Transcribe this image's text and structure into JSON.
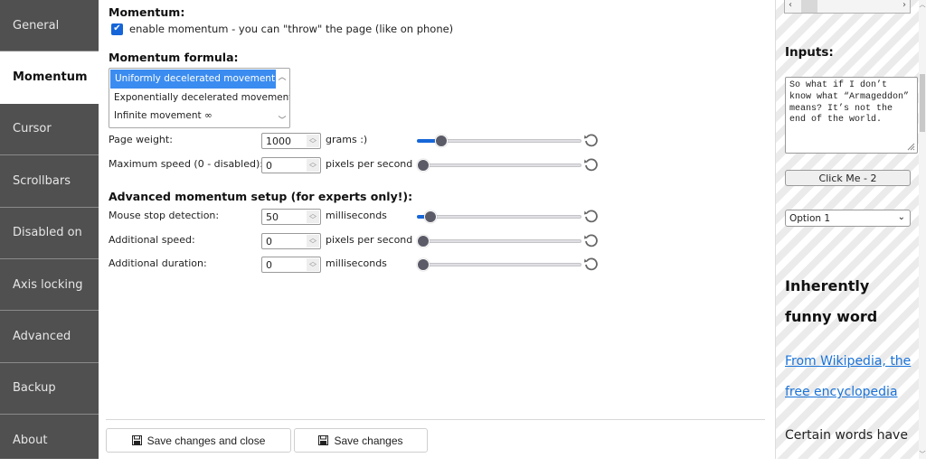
{
  "sidebar": {
    "items": [
      {
        "label": "General",
        "active": false
      },
      {
        "label": "Momentum",
        "active": true
      },
      {
        "label": "Cursor",
        "active": false
      },
      {
        "label": "Scrollbars",
        "active": false
      },
      {
        "label": "Disabled on",
        "active": false
      },
      {
        "label": "Axis locking",
        "active": false
      },
      {
        "label": "Advanced",
        "active": false
      },
      {
        "label": "Backup",
        "active": false
      },
      {
        "label": "About",
        "active": false
      }
    ]
  },
  "momentum": {
    "title": "Momentum:",
    "enable_checkbox": {
      "label": "enable momentum - you can \"throw\" the page (like on phone)",
      "checked": true
    }
  },
  "formula": {
    "title": "Momentum formula:",
    "options": [
      "Uniformly decelerated movement",
      "Exponentially decelerated movement",
      "Infinite movement ∞"
    ],
    "selected_index": 0
  },
  "basic_settings": [
    {
      "label": "Page weight:",
      "value": "1000",
      "unit": "grams :)",
      "slider_fraction": 0.12
    },
    {
      "label": "Maximum speed (0 - disabled):",
      "value": "0",
      "unit": "pixels per second",
      "slider_fraction": 0.0
    }
  ],
  "advanced": {
    "title": "Advanced momentum setup (for experts only!):",
    "settings": [
      {
        "label": "Mouse stop detection:",
        "value": "50",
        "unit": "milliseconds",
        "slider_fraction": 0.05
      },
      {
        "label": "Additional speed:",
        "value": "0",
        "unit": "pixels per second",
        "slider_fraction": 0.0
      },
      {
        "label": "Additional duration:",
        "value": "0",
        "unit": "milliseconds",
        "slider_fraction": 0.0
      }
    ]
  },
  "footer": {
    "save_close_label": "Save changes and close",
    "save_label": "Save changes"
  },
  "preview": {
    "inputs_title": "Inputs:",
    "textarea_value": "So what if I don’t know what “Armageddon” means? It’s not the end of the world.",
    "button_label": "Click Me - 2",
    "select_value": "Option 1",
    "heading_line1": "Inherently",
    "heading_line2": "funny word",
    "link_line1": "From Wikipedia, the",
    "link_line2": "free encyclopedia",
    "body_text": "Certain words have"
  },
  "colors": {
    "accent": "#1666d8",
    "sidebar_bg": "#505050",
    "link": "#1a73d9"
  }
}
